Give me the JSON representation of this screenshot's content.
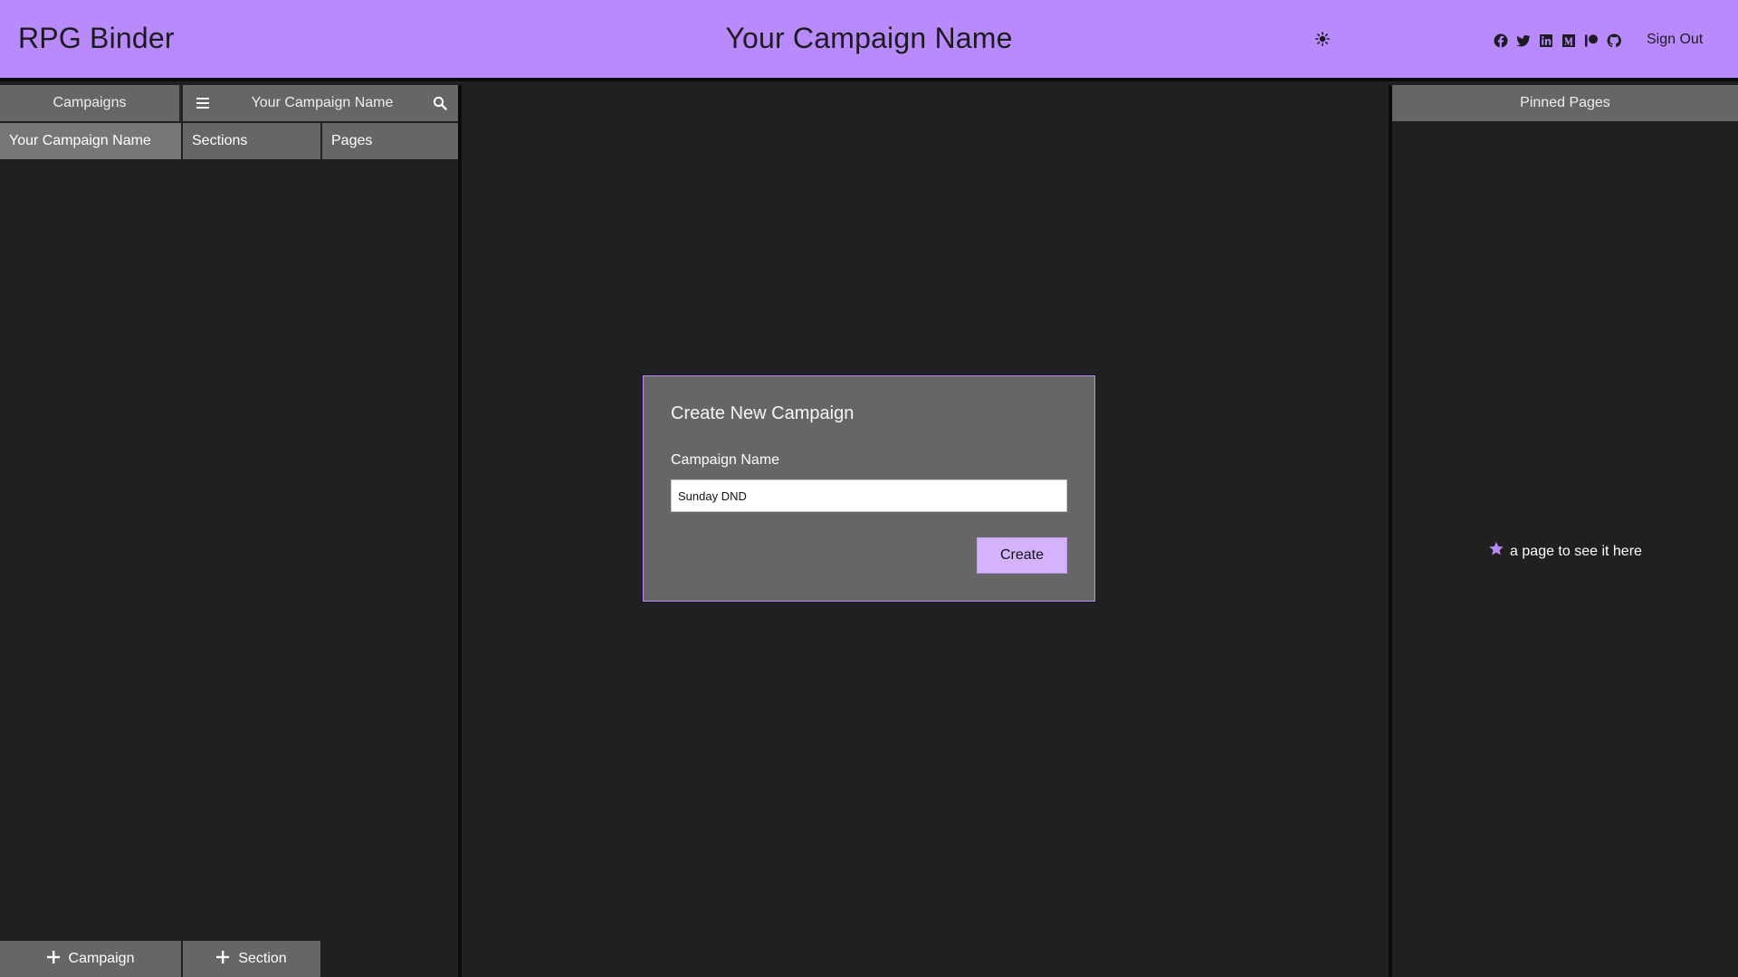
{
  "header": {
    "app_title": "RPG Binder",
    "campaign_title": "Your Campaign Name",
    "theme_icon": "sun-icon",
    "socials": [
      "facebook-icon",
      "twitter-icon",
      "linkedin-icon",
      "medium-icon",
      "patreon-icon",
      "github-icon"
    ],
    "sign_out_label": "Sign Out",
    "background_color": "#b98afb"
  },
  "left_panel": {
    "campaigns_tab_label": "Campaigns",
    "breadcrumb_name": "Your Campaign Name",
    "columns": {
      "campaign": "Your Campaign Name",
      "sections": "Sections",
      "pages": "Pages"
    },
    "add_campaign_label": "Campaign",
    "add_section_label": "Section"
  },
  "dialog": {
    "title": "Create New Campaign",
    "field_label": "Campaign Name",
    "field_value": "Sunday DND",
    "submit_label": "Create"
  },
  "right_panel": {
    "header_label": "Pinned Pages",
    "empty_text": "a page to see it here",
    "empty_icon": "star-icon"
  },
  "colors": {
    "accent": "#b98afb",
    "accent_light": "#d4b2fc",
    "panel": "#666666",
    "background": "#202020"
  }
}
